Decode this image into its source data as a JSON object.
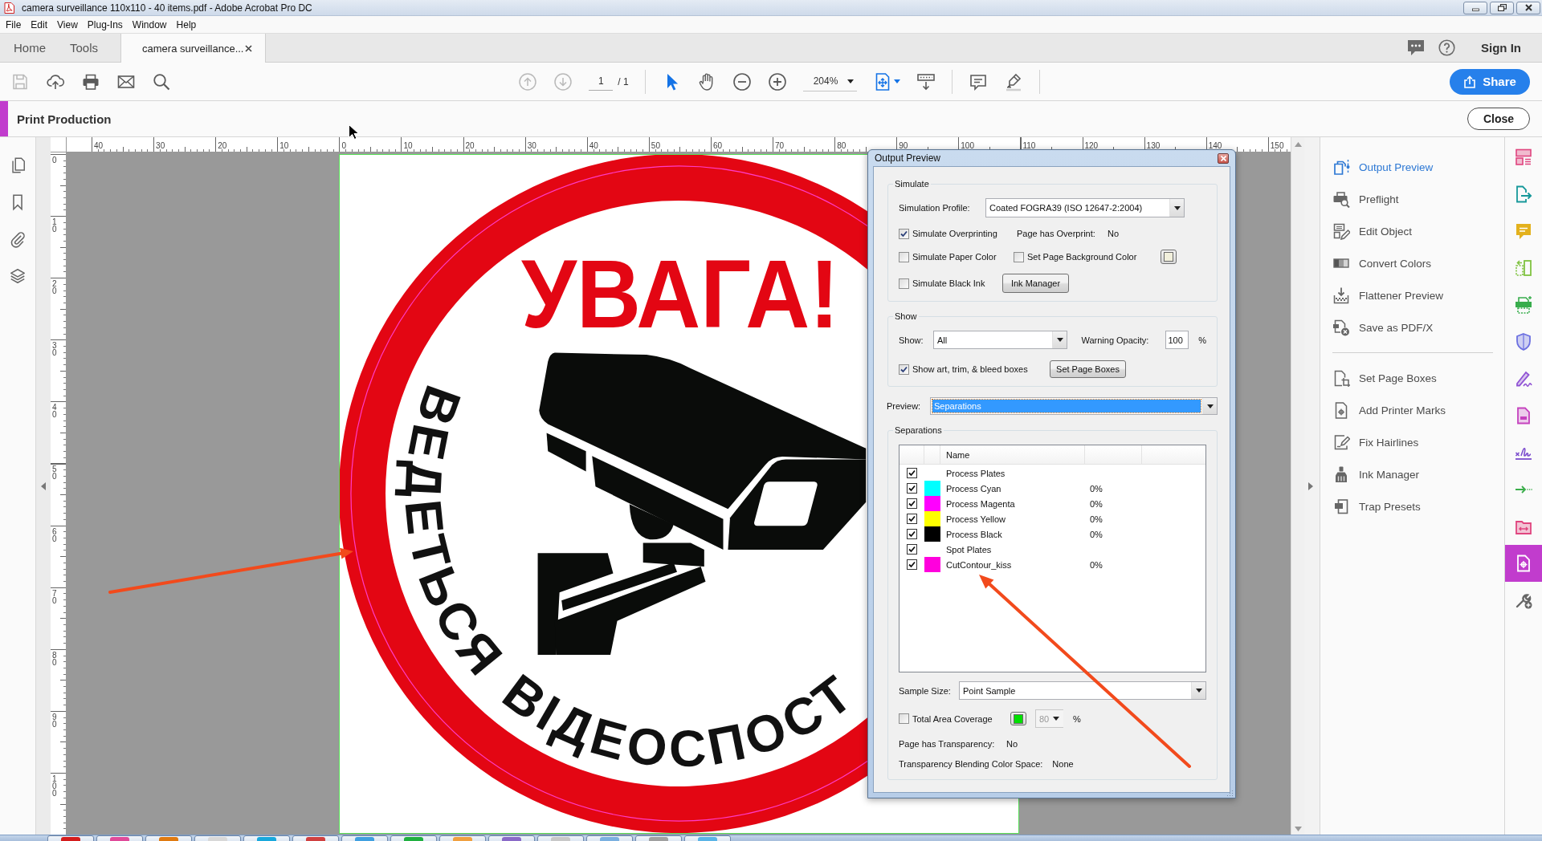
{
  "window": {
    "title": "camera surveillance 110x110 - 40 items.pdf - Adobe Acrobat Pro DC"
  },
  "menu_bar": [
    "File",
    "Edit",
    "View",
    "Plug-Ins",
    "Window",
    "Help"
  ],
  "tabs": [
    {
      "label": "Home",
      "kind": "view",
      "selected": false
    },
    {
      "label": "Tools",
      "kind": "view",
      "selected": false
    },
    {
      "label": "camera surveillance...",
      "kind": "document",
      "selected": true
    }
  ],
  "account": {
    "sign_in": "Sign In"
  },
  "toolbar": {
    "file_tools": [
      {
        "kind": "save",
        "disabled": true
      },
      {
        "kind": "upload",
        "disabled": false
      },
      {
        "kind": "print",
        "disabled": false
      },
      {
        "kind": "email",
        "disabled": false
      },
      {
        "kind": "search",
        "disabled": false
      }
    ],
    "page_nav": [
      {
        "kind": "previous",
        "disabled": true
      },
      {
        "kind": "next",
        "disabled": true
      }
    ],
    "page_number": "1",
    "page_count": "/ 1",
    "tools": [
      {
        "kind": "select",
        "selected": true
      },
      {
        "kind": "hand",
        "selected": false
      }
    ],
    "zoom": "204%",
    "share": "Share"
  },
  "print_production": {
    "title": "Print Production",
    "close": "Close"
  },
  "rulers": {
    "horizontal": [
      "40",
      "30",
      "20",
      "10",
      "0",
      "10",
      "20",
      "30",
      "40",
      "50",
      "60",
      "70",
      "80",
      "90",
      "100",
      "110",
      "120",
      "130",
      "140",
      "150"
    ],
    "vertical": [
      "0",
      "10",
      "20",
      "30",
      "40",
      "50",
      "60",
      "70",
      "80",
      "90",
      "100"
    ]
  },
  "document": {
    "headline": "УВАГА!",
    "arc_text": [
      "ВЕДЕТЬСЯ",
      "ВІДЕОСПОСТ"
    ]
  },
  "output_preview": {
    "title": "Output Preview",
    "simulate": {
      "legend": "Simulate",
      "profile_label": "Simulation Profile:",
      "profile": "Coated FOGRA39 (ISO 12647-2:2004)",
      "options": [
        {
          "label": "Simulate Overprinting",
          "checked": true
        },
        {
          "label": "Simulate Paper Color",
          "checked": false
        },
        {
          "label": "Set Page Background Color",
          "checked": false
        },
        {
          "label": "Simulate Black Ink",
          "checked": false
        }
      ],
      "overprint_label": "Page has Overprint:",
      "overprint_value": "No",
      "page_background": {
        "color": "#f2f0dc"
      },
      "ink_manager": "Ink Manager"
    },
    "show": {
      "legend": "Show",
      "show_label": "Show:",
      "show_value": "All",
      "opacity_label": "Warning Opacity:",
      "opacity": "100",
      "opacity_unit": "%",
      "boxes": {
        "label": "Show art, trim, & bleed boxes",
        "checked": true
      },
      "set_page_boxes": "Set Page Boxes"
    },
    "preview": {
      "label": "Preview:",
      "value": "Separations",
      "focused": true
    },
    "separations": {
      "legend": "Separations",
      "column": "Name",
      "rows": [
        {
          "name": "Process Plates",
          "checked": true
        },
        {
          "name": "Process Cyan",
          "checked": true,
          "color": "#00ffff",
          "coverage": "0%"
        },
        {
          "name": "Process Magenta",
          "checked": true,
          "color": "#ff00ff",
          "coverage": "0%"
        },
        {
          "name": "Process Yellow",
          "checked": true,
          "color": "#ffff00",
          "coverage": "0%"
        },
        {
          "name": "Process Black",
          "checked": true,
          "color": "#000000",
          "coverage": "0%"
        },
        {
          "name": "Spot Plates",
          "checked": true
        },
        {
          "name": "CutContour_kiss",
          "checked": true,
          "color": "#ff00dd",
          "coverage": "0%"
        }
      ],
      "sample_label": "Sample Size:",
      "sample_value": "Point Sample",
      "tac": {
        "label": "Total Area Coverage",
        "checked": false,
        "color": "#00e000",
        "value": "80",
        "disabled": true,
        "unit": "%"
      },
      "transparency_label": "Page has Transparency:",
      "transparency_value": "No",
      "blending_label": "Transparency Blending Color Space:",
      "blending_value": "None"
    }
  },
  "tools_panel": {
    "groups": [
      [
        {
          "label": "Output Preview",
          "kind": "output",
          "selected": true
        },
        {
          "label": "Preflight",
          "kind": "preflight",
          "selected": false
        },
        {
          "label": "Edit Object",
          "kind": "edit",
          "selected": false
        },
        {
          "label": "Convert Colors",
          "kind": "convert",
          "selected": false
        },
        {
          "label": "Flattener Preview",
          "kind": "flatten",
          "selected": false
        },
        {
          "label": "Save as PDF/X",
          "kind": "pdfx",
          "selected": false
        }
      ],
      [
        {
          "label": "Set Page Boxes",
          "kind": "boxes",
          "selected": false
        },
        {
          "label": "Add Printer Marks",
          "kind": "marks",
          "selected": false
        },
        {
          "label": "Fix Hairlines",
          "kind": "hairlines",
          "selected": false
        },
        {
          "label": "Ink Manager",
          "kind": "ink",
          "selected": false
        },
        {
          "label": "Trap Presets",
          "kind": "trap",
          "selected": false
        }
      ]
    ]
  },
  "tools_rail": [
    {
      "kind": "layout",
      "selected": false
    },
    {
      "kind": "export",
      "selected": false
    },
    {
      "kind": "comment",
      "selected": false
    },
    {
      "kind": "organize",
      "selected": false
    },
    {
      "kind": "scan",
      "selected": false
    },
    {
      "kind": "protect",
      "selected": false
    },
    {
      "kind": "sign",
      "selected": false
    },
    {
      "kind": "form",
      "selected": false
    },
    {
      "kind": "fillsign",
      "selected": false
    },
    {
      "kind": "send",
      "selected": false
    },
    {
      "kind": "compare",
      "selected": false
    },
    {
      "kind": "production",
      "selected": true
    },
    {
      "kind": "tools",
      "selected": false
    }
  ]
}
